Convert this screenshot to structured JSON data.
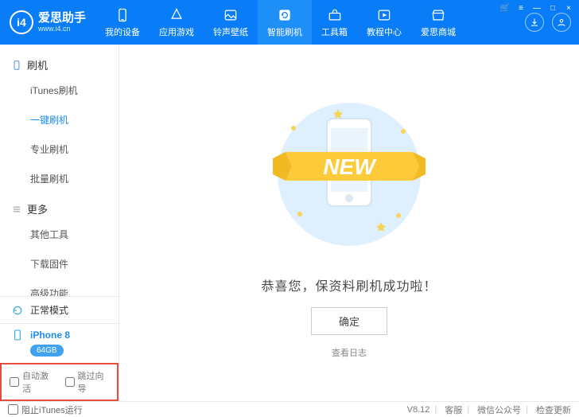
{
  "app": {
    "title": "爱思助手",
    "url": "www.i4.cn",
    "logo_mark": "i4"
  },
  "window_controls": {
    "cart": "🛒",
    "menu": "≡",
    "min": "—",
    "max": "□",
    "close": "×"
  },
  "tabs": [
    {
      "label": "我的设备",
      "active": false
    },
    {
      "label": "应用游戏",
      "active": false
    },
    {
      "label": "铃声壁纸",
      "active": false
    },
    {
      "label": "智能刷机",
      "active": true
    },
    {
      "label": "工具箱",
      "active": false
    },
    {
      "label": "教程中心",
      "active": false
    },
    {
      "label": "爱思商城",
      "active": false
    }
  ],
  "sidebar": {
    "group_flash": "刷机",
    "items_flash": [
      {
        "label": "iTunes刷机",
        "active": false
      },
      {
        "label": "一键刷机",
        "active": true
      },
      {
        "label": "专业刷机",
        "active": false
      },
      {
        "label": "批量刷机",
        "active": false
      }
    ],
    "group_more": "更多",
    "items_more": [
      {
        "label": "其他工具",
        "active": false
      },
      {
        "label": "下载固件",
        "active": false
      },
      {
        "label": "高级功能",
        "active": false
      }
    ],
    "mode": "正常模式",
    "device_name": "iPhone 8",
    "device_badge": "64GB",
    "auto_activate": "自动激活",
    "skip_wizard": "跳过向导"
  },
  "content": {
    "message": "恭喜您，保资料刷机成功啦！",
    "ok_label": "确定",
    "view_log": "查看日志",
    "new_text": "NEW"
  },
  "status": {
    "block_itunes": "阻止iTunes运行",
    "version": "V8.12",
    "items": [
      "客服",
      "微信公众号",
      "检查更新"
    ]
  }
}
